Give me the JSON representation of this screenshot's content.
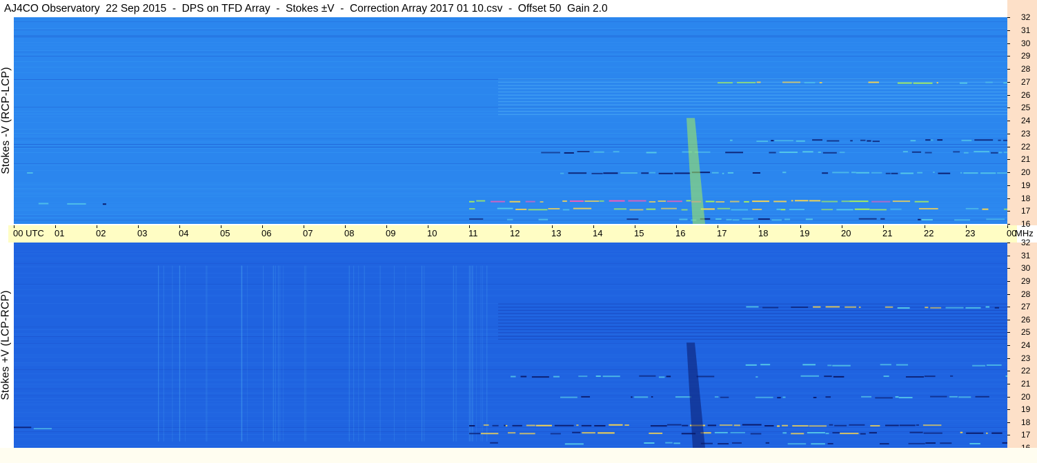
{
  "title": "AJ4CO Observatory  22 Sep 2015  -  DPS on TFD Array  -  Stokes ±V  -  Correction Array 2017 01 10.csv  -  Offset 50  Gain 2.0",
  "chart_data": [
    {
      "type": "heatmap",
      "ylabel": "Stokes -V (RCP-LCP)",
      "x_unit": "UTC",
      "y_unit": "MHz",
      "xlim_hours": [
        0,
        24
      ],
      "ylim_mhz": [
        16,
        32
      ],
      "colorscale": [
        "#0a1a6a",
        "#1a55d6",
        "#2a8cf0",
        "#55c8e8",
        "#a8f05a",
        "#ffd84a",
        "#ff5ab4"
      ],
      "polarity": "positive"
    },
    {
      "type": "heatmap",
      "ylabel": "Stokes +V (LCP-RCP)",
      "x_unit": "UTC",
      "y_unit": "MHz",
      "xlim_hours": [
        0,
        24
      ],
      "ylim_mhz": [
        16,
        32
      ],
      "colorscale": [
        "#0a1a6a",
        "#1a55d6",
        "#2a8cf0",
        "#55c8e8",
        "#a8f05a",
        "#ffd84a",
        "#ff5ab4"
      ],
      "polarity": "negative"
    }
  ],
  "time_axis": {
    "labels": [
      "00  UTC",
      "01",
      "02",
      "03",
      "04",
      "05",
      "06",
      "07",
      "08",
      "09",
      "10",
      "11",
      "12",
      "13",
      "14",
      "15",
      "16",
      "17",
      "18",
      "19",
      "20",
      "21",
      "22",
      "23",
      "00"
    ],
    "unit_label": "MHz"
  },
  "freq_axis": {
    "labels": [
      "32",
      "31",
      "30",
      "29",
      "28",
      "27",
      "26",
      "25",
      "24",
      "23",
      "22",
      "21",
      "20",
      "19",
      "18",
      "17",
      "16"
    ]
  },
  "colors": {
    "freq_axis_bg": "#fde0c8",
    "time_axis_bg": "#fffdc4",
    "plot_background": "#2a8cf0"
  }
}
